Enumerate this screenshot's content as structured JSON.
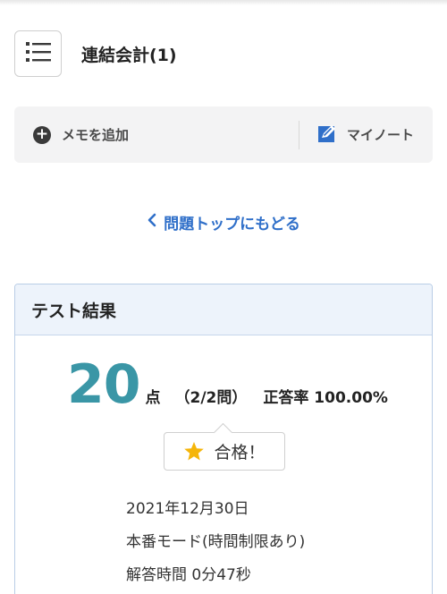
{
  "header": {
    "title": "連結会計(1)",
    "menu_icon": "list-icon"
  },
  "memo_bar": {
    "add_label": "メモを追加",
    "add_icon": "plus-circle-icon",
    "my_note_label": "マイノート",
    "my_note_icon": "edit-note-icon"
  },
  "navigation": {
    "back_label": "問題トップにもどる",
    "back_icon": "chevron-left-icon"
  },
  "result": {
    "heading": "テスト結果",
    "score": "20",
    "score_unit": "点",
    "questions": "（2/2問）",
    "correct_rate_text": "正答率 100.00%",
    "badge_icon": "star-icon",
    "badge_label": "合格！",
    "date": "2021年12月30日",
    "mode": "本番モード(時間制限あり)",
    "answer_time": "解答時間 0分47秒"
  },
  "colors": {
    "accent_link": "#2f6fc9",
    "score": "#3a96a6",
    "card_header_bg": "#edf3fb",
    "card_border": "#b9cde6",
    "star": "#f5b50a"
  }
}
